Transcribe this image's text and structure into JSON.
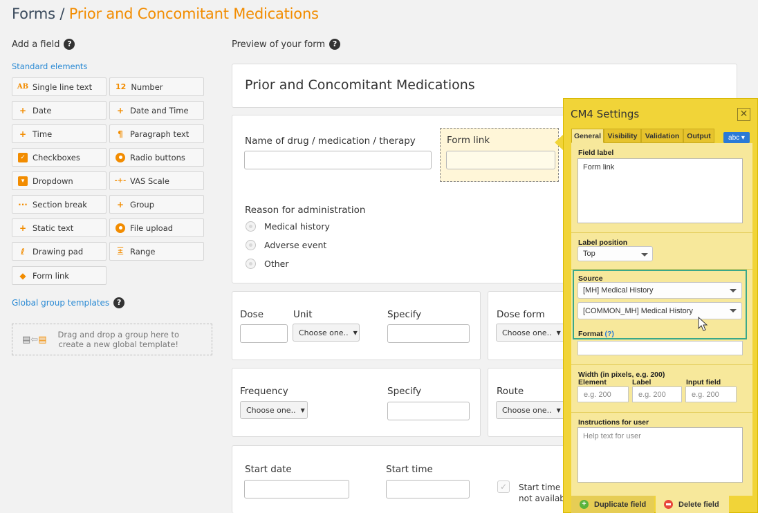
{
  "header": {
    "prefix": "Forms /",
    "title": "Prior and Concomitant Medications"
  },
  "left": {
    "add_field": "Add a field",
    "standard_elements": "Standard elements",
    "elements": [
      {
        "label": "Single line text",
        "icon": "AB"
      },
      {
        "label": "Number",
        "icon": "12"
      },
      {
        "label": "Date",
        "icon": "+"
      },
      {
        "label": "Date and Time",
        "icon": "+"
      },
      {
        "label": "Time",
        "icon": "+"
      },
      {
        "label": "Paragraph text",
        "icon": "¶"
      },
      {
        "label": "Checkboxes",
        "icon": "✓"
      },
      {
        "label": "Radio buttons",
        "icon": "radio"
      },
      {
        "label": "Dropdown",
        "icon": "▾"
      },
      {
        "label": "VAS Scale",
        "icon": "vas"
      },
      {
        "label": "Section break",
        "icon": "···"
      },
      {
        "label": "Group",
        "icon": "+"
      },
      {
        "label": "Static text",
        "icon": "+"
      },
      {
        "label": "File upload",
        "icon": "upload"
      },
      {
        "label": "Drawing pad",
        "icon": "pen"
      },
      {
        "label": "Range",
        "icon": "range"
      },
      {
        "label": "Form link",
        "icon": "tag"
      }
    ],
    "global_templates": "Global group templates",
    "drop_hint_line1": "Drag and drop a group here to",
    "drop_hint_line2": "create a new global template!"
  },
  "preview": {
    "heading": "Preview of your form",
    "form_title": "Prior and Concomitant Medications",
    "drug_label": "Name of drug / medication / therapy",
    "form_link_label": "Form link",
    "reason_label": "Reason for administration",
    "reason_options": [
      "Medical history",
      "Adverse event",
      "Other"
    ],
    "dose": "Dose",
    "unit": "Unit",
    "specify": "Specify",
    "dose_form": "Dose form",
    "choose_one": "Choose one..",
    "frequency": "Frequency",
    "route": "Route",
    "start_date": "Start date",
    "start_time": "Start time",
    "start_time_na_1": "Start time",
    "start_time_na_2": "not availab"
  },
  "settings": {
    "title": "CM4 Settings",
    "close": "✕",
    "tabs": [
      "General",
      "Visibility",
      "Validation",
      "Output"
    ],
    "abc": "abc ▾",
    "field_label_title": "Field label",
    "field_label_value": "Form link",
    "label_position_title": "Label position",
    "label_position_value": "Top",
    "source_title": "Source",
    "source_1": "[MH] Medical History",
    "source_2": "[COMMON_MH] Medical History",
    "format_title": "Format",
    "format_help": "(?)",
    "width_title": "Width (in pixels, e.g. 200)",
    "width_element": "Element",
    "width_label": "Label",
    "width_input": "Input field",
    "width_placeholder": "e.g. 200",
    "instructions_title": "Instructions for user",
    "instructions_placeholder": "Help text for user",
    "duplicate": "Duplicate field",
    "delete": "Delete field"
  }
}
